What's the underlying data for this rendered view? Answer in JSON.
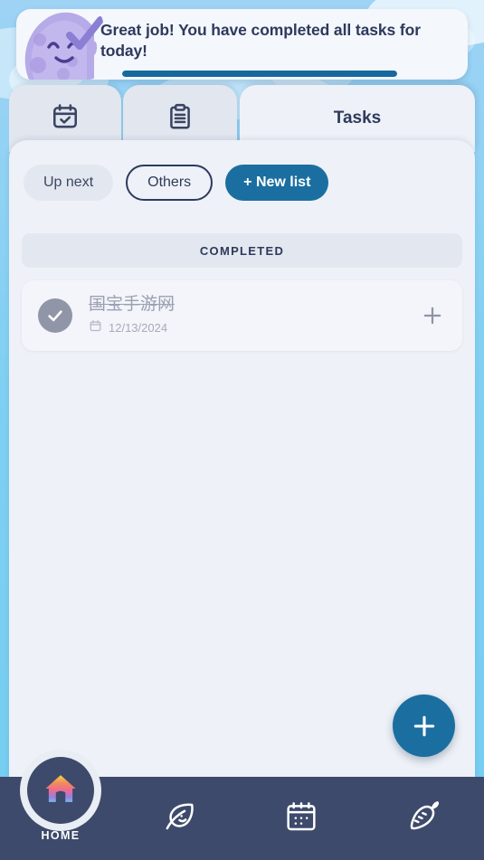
{
  "banner": {
    "message": "Great job! You have completed all tasks for today!",
    "progress_percent": 100,
    "progress_color": "#16699c",
    "mascot_icon": "purple-blob-mascot-with-checkmark"
  },
  "tabs": [
    {
      "id": "calendar",
      "icon": "calendar-check-icon",
      "label": "",
      "active": false
    },
    {
      "id": "lists",
      "icon": "clipboard-list-icon",
      "label": "",
      "active": false
    },
    {
      "id": "tasks",
      "icon": "",
      "label": "Tasks",
      "active": true
    }
  ],
  "filters": [
    {
      "id": "up-next",
      "label": "Up next",
      "style": "plain"
    },
    {
      "id": "others",
      "label": "Others",
      "style": "outlined"
    },
    {
      "id": "new-list",
      "label": "+ New list",
      "style": "primary"
    }
  ],
  "sections": [
    {
      "id": "completed",
      "header": "COMPLETED",
      "tasks": [
        {
          "title": "国宝手游网",
          "date": "12/13/2024",
          "completed": true,
          "check_icon": "check-circle-filled-icon",
          "date_icon": "calendar-small-icon",
          "add_icon": "plus-icon"
        }
      ]
    }
  ],
  "fab": {
    "icon": "plus-icon",
    "color": "#1b6fa0"
  },
  "bottom_nav": {
    "active_label": "HOME",
    "items": [
      {
        "id": "home",
        "icon": "rainbow-house-icon",
        "label": "HOME",
        "active": true
      },
      {
        "id": "mindful",
        "icon": "leaf-smile-icon",
        "label": "",
        "active": false
      },
      {
        "id": "calendar",
        "icon": "calendar-dots-icon",
        "label": "",
        "active": false
      },
      {
        "id": "nutrition",
        "icon": "carrot-icon",
        "label": "",
        "active": false
      }
    ]
  },
  "theme": {
    "sky_blue": "#7fd0f2",
    "panel": "#eef1f7",
    "navy": "#2e3a5c",
    "accent_blue": "#1b6fa0",
    "nav_bar": "#3e4a6b",
    "muted_gray": "#9ba0b2"
  }
}
